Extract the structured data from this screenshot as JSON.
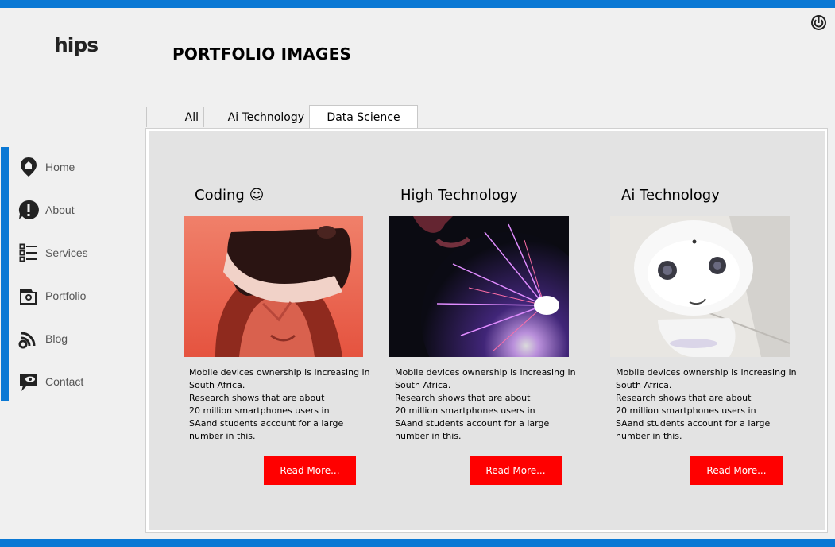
{
  "app": {
    "logo": "hips",
    "page_title": "PORTFOLIO IMAGES"
  },
  "colors": {
    "accent": "#0a78d4",
    "button": "#ff0000",
    "panel": "#e3e3e3"
  },
  "sidebar": {
    "items": [
      {
        "label": "Home",
        "icon": "home-pin-icon"
      },
      {
        "label": "About",
        "icon": "info-alert-icon"
      },
      {
        "label": "Services",
        "icon": "list-icon"
      },
      {
        "label": "Portfolio",
        "icon": "camera-icon"
      },
      {
        "label": "Blog",
        "icon": "blog-feed-icon"
      },
      {
        "label": "Contact",
        "icon": "chat-eye-icon"
      }
    ]
  },
  "tabs": [
    {
      "label": "All",
      "active": false
    },
    {
      "label": "Ai Technology",
      "active": false
    },
    {
      "label": "Data Science",
      "active": true
    }
  ],
  "cards": [
    {
      "title": "Coding ☺",
      "image": "vr-headset-photo",
      "text": "Mobile devices ownership is increasing in\nSouth Africa.\nResearch shows that are about\n 20 million smartphones users in\nSAand students account for a large\n number in this.",
      "button": "Read More..."
    },
    {
      "title": "High Technology",
      "image": "plasma-ball-photo",
      "text": "Mobile devices ownership is increasing in\nSouth Africa.\nResearch shows that are about\n 20 million smartphones users in\nSAand students account for a large\n number in this.",
      "button": "Read More..."
    },
    {
      "title": "Ai Technology",
      "image": "robot-photo",
      "text": "Mobile devices ownership is increasing in\nSouth Africa.\nResearch shows that are about\n 20 million smartphones users in\nSAand students account for a large\n number in this.",
      "button": "Read More..."
    }
  ]
}
